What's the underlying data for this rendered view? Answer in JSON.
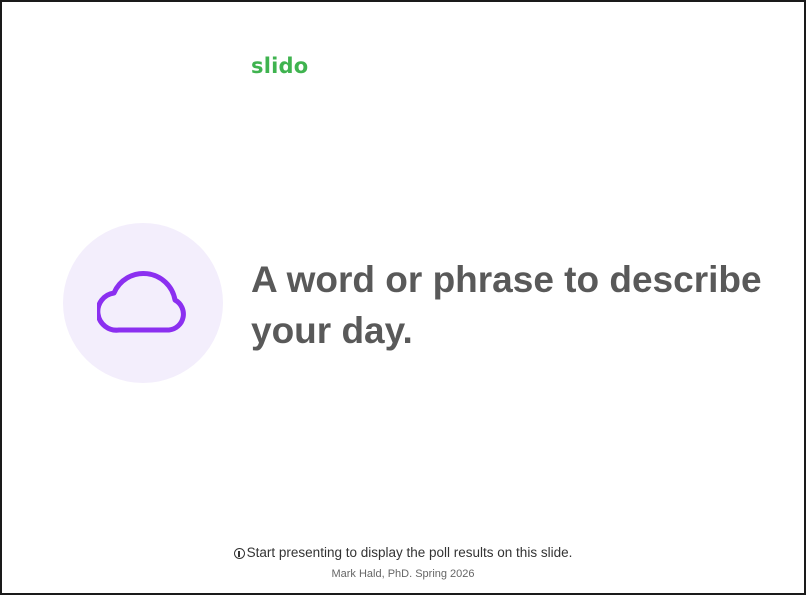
{
  "brand": {
    "logo_text": "slido",
    "logo_color": "#3fb34f"
  },
  "poll": {
    "icon": "cloud-icon",
    "icon_color": "#8b2ff0",
    "icon_background": "#f3eefc",
    "question": "A word or phrase to describe your day."
  },
  "notice": {
    "icon": "info-icon",
    "text": "Start presenting to display the poll results on this slide."
  },
  "footer": {
    "text": "Mark Hald, PhD.  Spring 2026"
  }
}
